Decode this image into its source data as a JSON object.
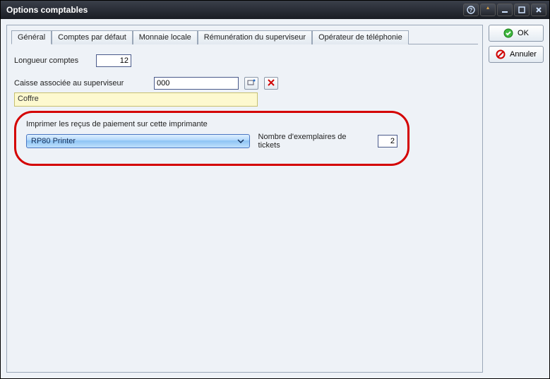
{
  "window": {
    "title": "Options comptables"
  },
  "buttons": {
    "ok": "OK",
    "cancel": "Annuler"
  },
  "tabs": [
    {
      "label": "Général",
      "active": true
    },
    {
      "label": "Comptes par défaut",
      "active": false
    },
    {
      "label": "Monnaie locale",
      "active": false
    },
    {
      "label": "Rémunération du superviseur",
      "active": false
    },
    {
      "label": "Opérateur de téléphonie",
      "active": false
    }
  ],
  "fields": {
    "account_length_label": "Longueur comptes",
    "account_length_value": "12",
    "supervisor_cash_label": "Caisse associée au superviseur",
    "supervisor_cash_value": "000",
    "supervisor_cash_name": "Coffre",
    "printer_group_label": "Imprimer les reçus de paiement sur cette imprimante",
    "printer_value": "RP80 Printer",
    "copies_label": "Nombre d'exemplaires de tickets",
    "copies_value": "2"
  },
  "icons": {
    "ok": "check-circle",
    "cancel": "forbidden",
    "lookup": "picker",
    "clear": "red-x"
  }
}
